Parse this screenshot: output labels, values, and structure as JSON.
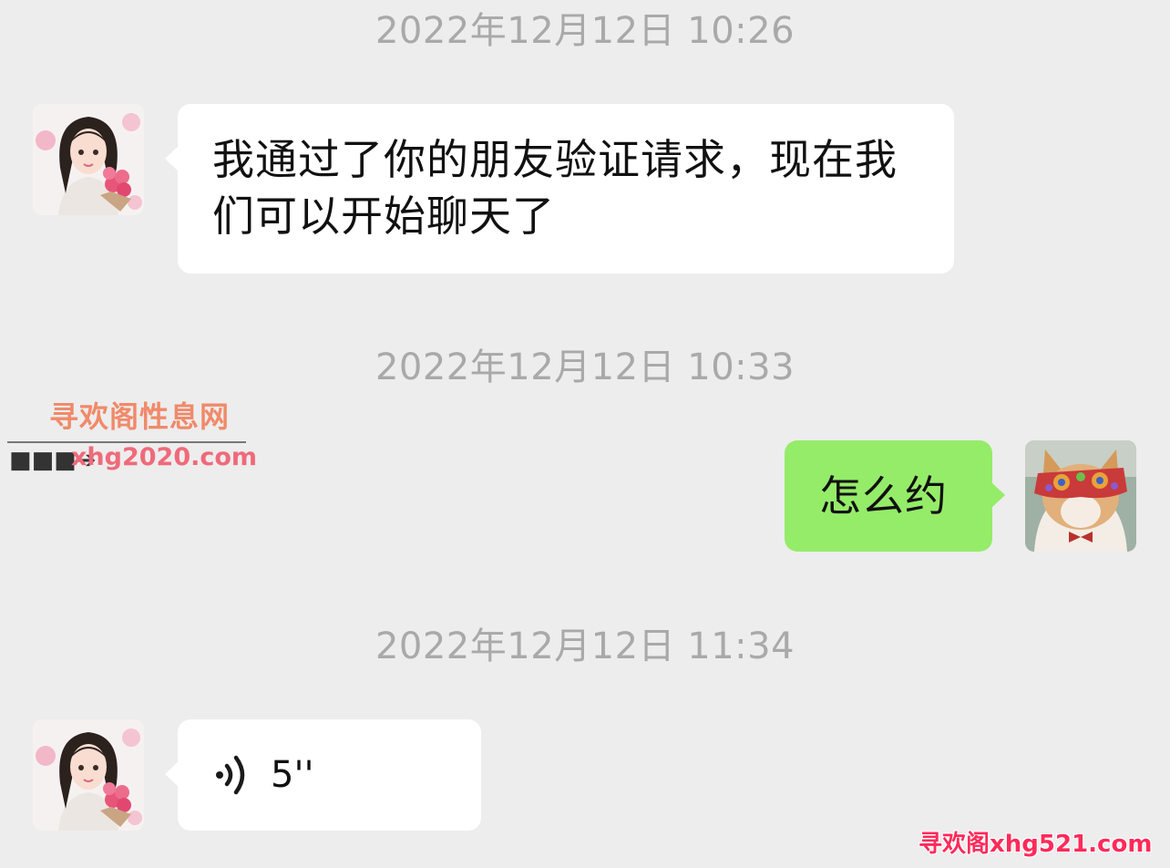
{
  "timestamps": [
    "2022年12月12日 10:26",
    "2022年12月12日 10:33",
    "2022年12月12日 11:34"
  ],
  "messages": [
    {
      "from": "contact",
      "type": "text",
      "text": "我通过了你的朋友验证请求，现在我们可以开始聊天了"
    },
    {
      "from": "me",
      "type": "text",
      "text": "怎么约"
    },
    {
      "from": "contact",
      "type": "voice",
      "duration": "5''"
    }
  ],
  "avatars": {
    "contact": "girl-with-flowers-avatar",
    "me": "cat-with-mask-avatar"
  },
  "watermarks": {
    "site_name": "寻欢阁性息网",
    "site_url": "xhg2020.com",
    "corner_text": "寻欢阁xhg521.com"
  },
  "colors": {
    "background": "#ededed",
    "incoming_bubble": "#ffffff",
    "outgoing_bubble": "#95ec69",
    "timestamp_text": "#a9a9a9"
  }
}
